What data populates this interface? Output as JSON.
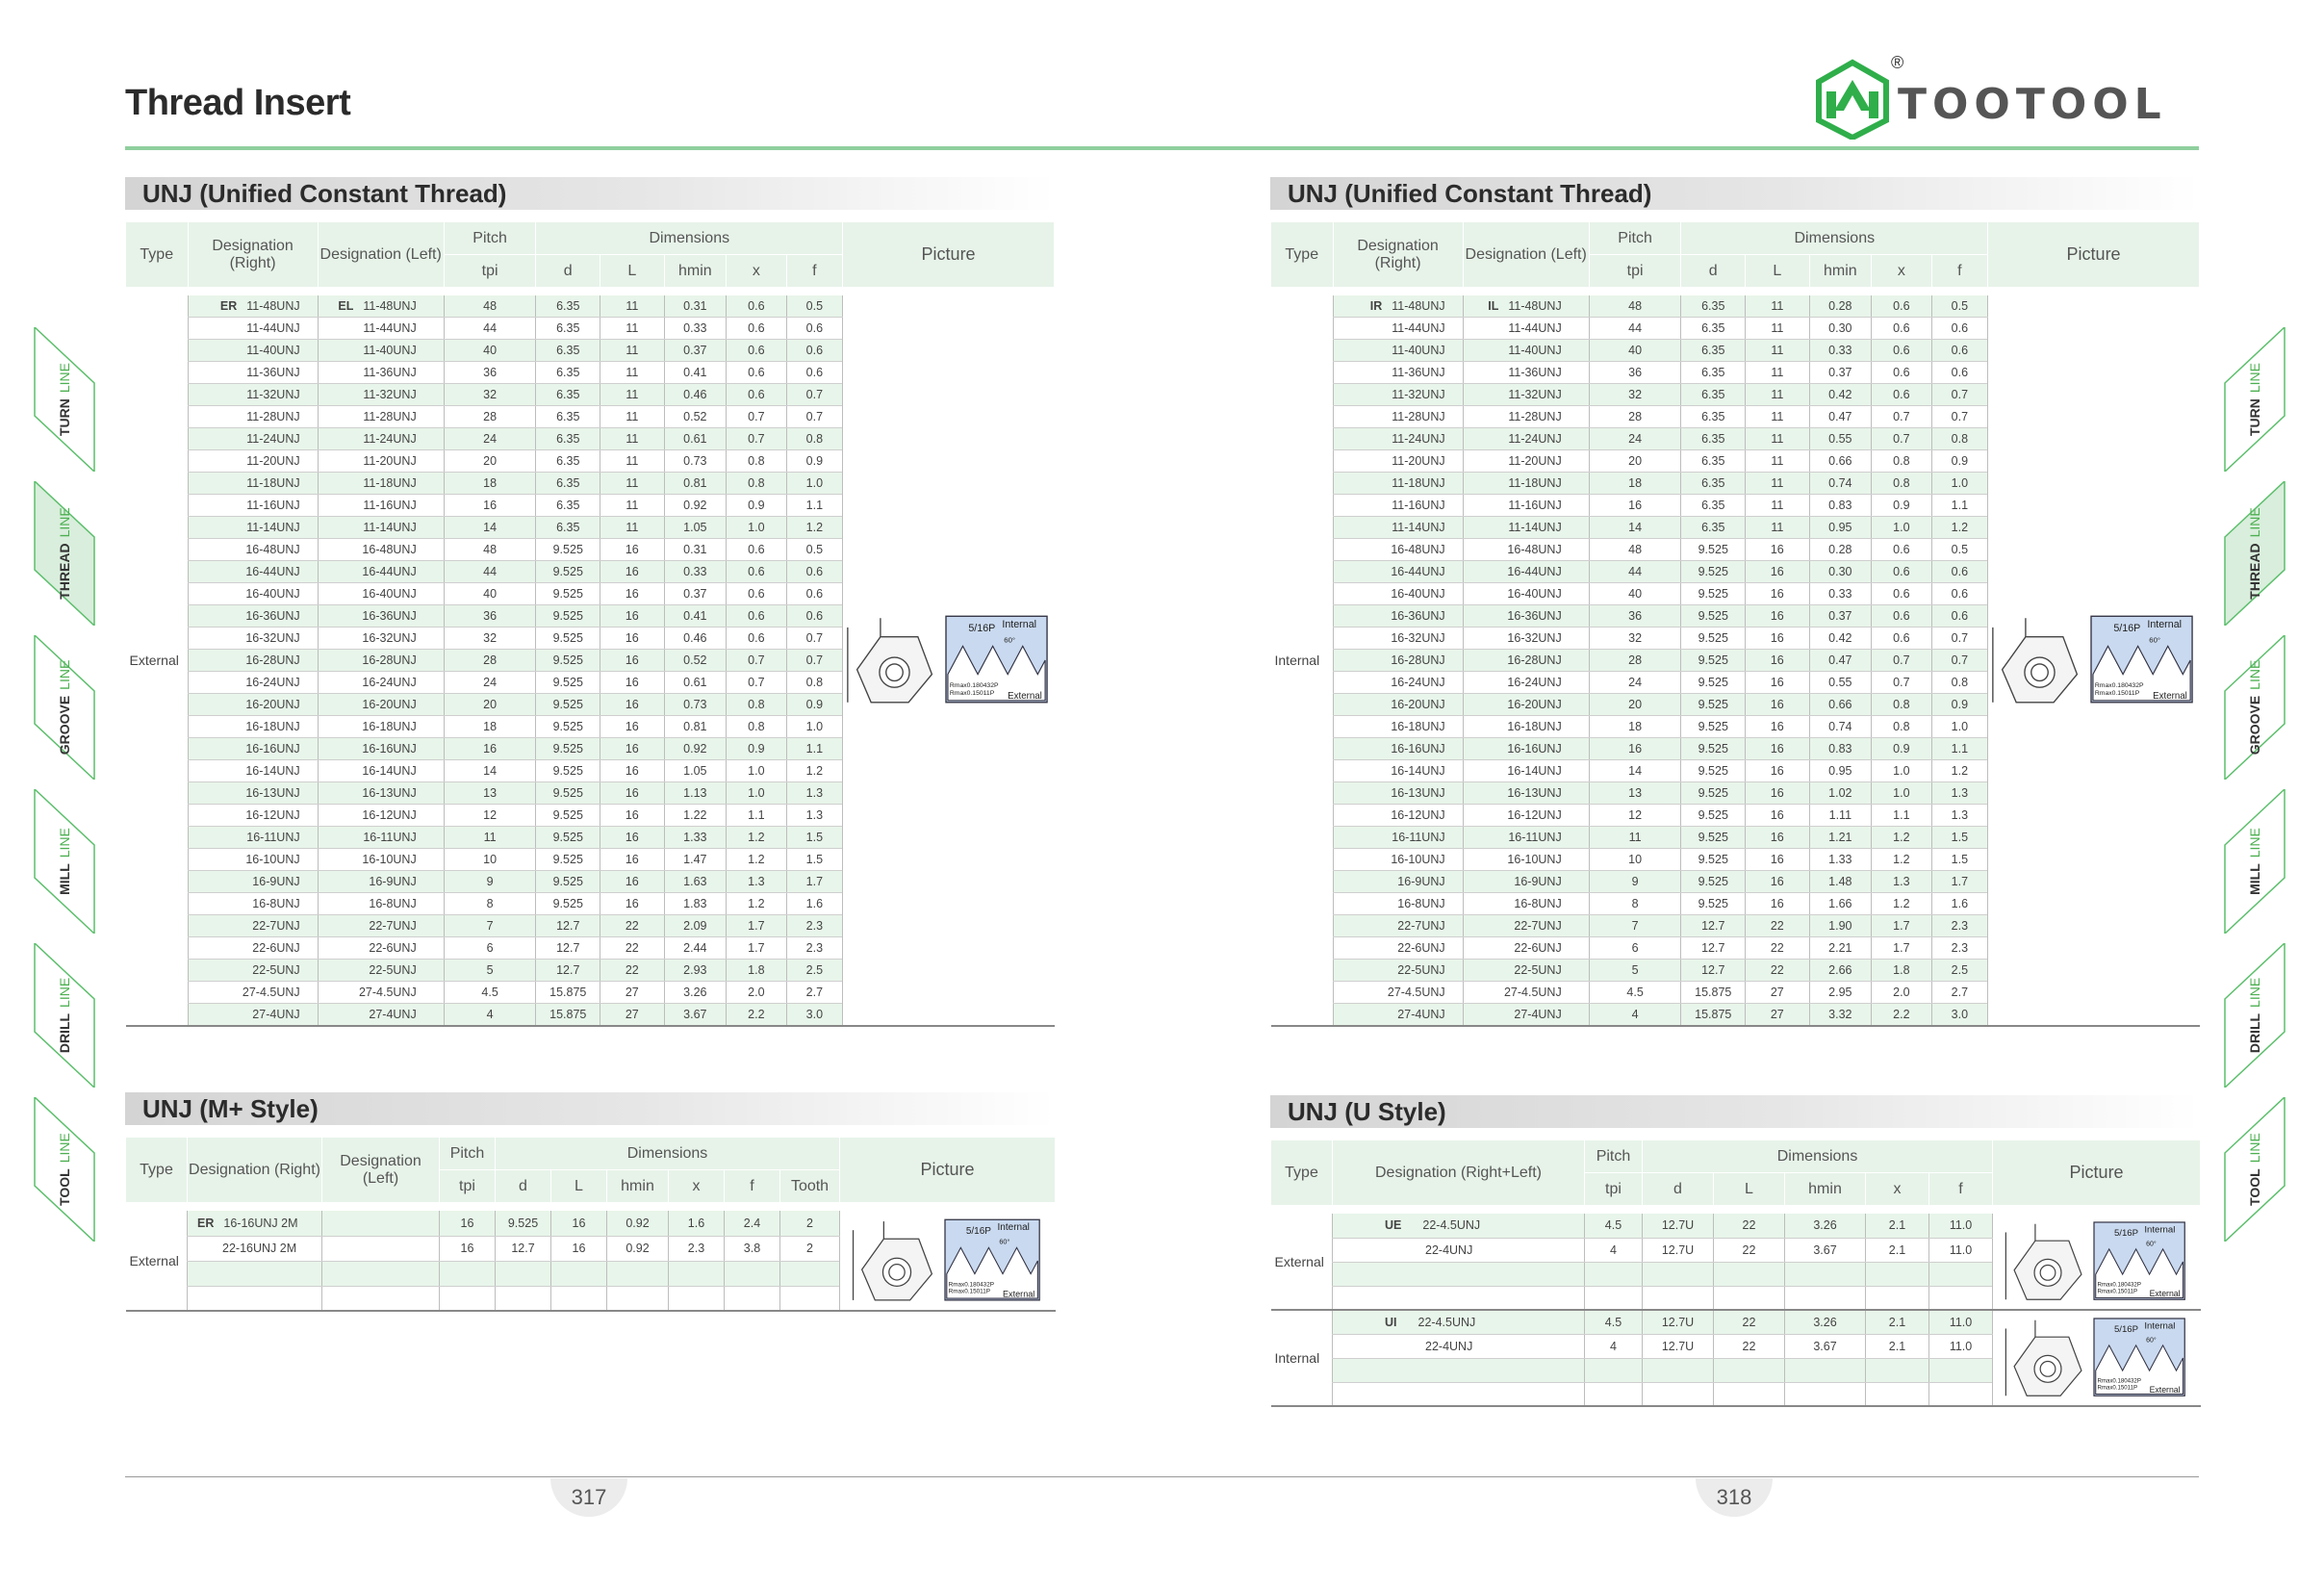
{
  "page_title": "Thread Insert",
  "logo": {
    "text": "TOOTOOL",
    "reg": "®",
    "color": "#2fae4a"
  },
  "side_tabs": [
    {
      "main": "TURN",
      "sub": "LINE"
    },
    {
      "main": "THREAD",
      "sub": "LINE"
    },
    {
      "main": "GROOVE",
      "sub": "LINE"
    },
    {
      "main": "MILL",
      "sub": "LINE"
    },
    {
      "main": "DRILL",
      "sub": "LINE"
    },
    {
      "main": "TOOL",
      "sub": "LINE"
    }
  ],
  "headers": {
    "type": "Type",
    "des_right": "Designation (Right)",
    "des_left": "Designation (Left)",
    "des_rl": "Designation (Right+Left)",
    "pitch": "Pitch",
    "tpi": "tpi",
    "dimensions": "Dimensions",
    "d": "d",
    "L": "L",
    "hmin": "hmin",
    "x": "x",
    "f": "f",
    "tooth": "Tooth",
    "picture": "Picture"
  },
  "pic_labels": {
    "pitch": "5/16P",
    "internal": "Internal",
    "external": "External",
    "angle": "60°",
    "r1": "Rmax0.180432P",
    "r2": "Rmax0.15011P"
  },
  "left_unj": {
    "title": "UNJ (Unified Constant Thread)",
    "type": "External",
    "tag_r": "ER",
    "tag_l": "EL",
    "rows": [
      [
        "11-48UNJ",
        "11-48UNJ",
        "48",
        "6.35",
        "11",
        "0.31",
        "0.6",
        "0.5"
      ],
      [
        "11-44UNJ",
        "11-44UNJ",
        "44",
        "6.35",
        "11",
        "0.33",
        "0.6",
        "0.6"
      ],
      [
        "11-40UNJ",
        "11-40UNJ",
        "40",
        "6.35",
        "11",
        "0.37",
        "0.6",
        "0.6"
      ],
      [
        "11-36UNJ",
        "11-36UNJ",
        "36",
        "6.35",
        "11",
        "0.41",
        "0.6",
        "0.6"
      ],
      [
        "11-32UNJ",
        "11-32UNJ",
        "32",
        "6.35",
        "11",
        "0.46",
        "0.6",
        "0.7"
      ],
      [
        "11-28UNJ",
        "11-28UNJ",
        "28",
        "6.35",
        "11",
        "0.52",
        "0.7",
        "0.7"
      ],
      [
        "11-24UNJ",
        "11-24UNJ",
        "24",
        "6.35",
        "11",
        "0.61",
        "0.7",
        "0.8"
      ],
      [
        "11-20UNJ",
        "11-20UNJ",
        "20",
        "6.35",
        "11",
        "0.73",
        "0.8",
        "0.9"
      ],
      [
        "11-18UNJ",
        "11-18UNJ",
        "18",
        "6.35",
        "11",
        "0.81",
        "0.8",
        "1.0"
      ],
      [
        "11-16UNJ",
        "11-16UNJ",
        "16",
        "6.35",
        "11",
        "0.92",
        "0.9",
        "1.1"
      ],
      [
        "11-14UNJ",
        "11-14UNJ",
        "14",
        "6.35",
        "11",
        "1.05",
        "1.0",
        "1.2"
      ],
      [
        "16-48UNJ",
        "16-48UNJ",
        "48",
        "9.525",
        "16",
        "0.31",
        "0.6",
        "0.5"
      ],
      [
        "16-44UNJ",
        "16-44UNJ",
        "44",
        "9.525",
        "16",
        "0.33",
        "0.6",
        "0.6"
      ],
      [
        "16-40UNJ",
        "16-40UNJ",
        "40",
        "9.525",
        "16",
        "0.37",
        "0.6",
        "0.6"
      ],
      [
        "16-36UNJ",
        "16-36UNJ",
        "36",
        "9.525",
        "16",
        "0.41",
        "0.6",
        "0.6"
      ],
      [
        "16-32UNJ",
        "16-32UNJ",
        "32",
        "9.525",
        "16",
        "0.46",
        "0.6",
        "0.7"
      ],
      [
        "16-28UNJ",
        "16-28UNJ",
        "28",
        "9.525",
        "16",
        "0.52",
        "0.7",
        "0.7"
      ],
      [
        "16-24UNJ",
        "16-24UNJ",
        "24",
        "9.525",
        "16",
        "0.61",
        "0.7",
        "0.8"
      ],
      [
        "16-20UNJ",
        "16-20UNJ",
        "20",
        "9.525",
        "16",
        "0.73",
        "0.8",
        "0.9"
      ],
      [
        "16-18UNJ",
        "16-18UNJ",
        "18",
        "9.525",
        "16",
        "0.81",
        "0.8",
        "1.0"
      ],
      [
        "16-16UNJ",
        "16-16UNJ",
        "16",
        "9.525",
        "16",
        "0.92",
        "0.9",
        "1.1"
      ],
      [
        "16-14UNJ",
        "16-14UNJ",
        "14",
        "9.525",
        "16",
        "1.05",
        "1.0",
        "1.2"
      ],
      [
        "16-13UNJ",
        "16-13UNJ",
        "13",
        "9.525",
        "16",
        "1.13",
        "1.0",
        "1.3"
      ],
      [
        "16-12UNJ",
        "16-12UNJ",
        "12",
        "9.525",
        "16",
        "1.22",
        "1.1",
        "1.3"
      ],
      [
        "16-11UNJ",
        "16-11UNJ",
        "11",
        "9.525",
        "16",
        "1.33",
        "1.2",
        "1.5"
      ],
      [
        "16-10UNJ",
        "16-10UNJ",
        "10",
        "9.525",
        "16",
        "1.47",
        "1.2",
        "1.5"
      ],
      [
        "16-9UNJ",
        "16-9UNJ",
        "9",
        "9.525",
        "16",
        "1.63",
        "1.3",
        "1.7"
      ],
      [
        "16-8UNJ",
        "16-8UNJ",
        "8",
        "9.525",
        "16",
        "1.83",
        "1.2",
        "1.6"
      ],
      [
        "22-7UNJ",
        "22-7UNJ",
        "7",
        "12.7",
        "22",
        "2.09",
        "1.7",
        "2.3"
      ],
      [
        "22-6UNJ",
        "22-6UNJ",
        "6",
        "12.7",
        "22",
        "2.44",
        "1.7",
        "2.3"
      ],
      [
        "22-5UNJ",
        "22-5UNJ",
        "5",
        "12.7",
        "22",
        "2.93",
        "1.8",
        "2.5"
      ],
      [
        "27-4.5UNJ",
        "27-4.5UNJ",
        "4.5",
        "15.875",
        "27",
        "3.26",
        "2.0",
        "2.7"
      ],
      [
        "27-4UNJ",
        "27-4UNJ",
        "4",
        "15.875",
        "27",
        "3.67",
        "2.2",
        "3.0"
      ]
    ]
  },
  "right_unj": {
    "title": "UNJ (Unified Constant Thread)",
    "type": "Internal",
    "tag_r": "IR",
    "tag_l": "IL",
    "rows": [
      [
        "11-48UNJ",
        "11-48UNJ",
        "48",
        "6.35",
        "11",
        "0.28",
        "0.6",
        "0.5"
      ],
      [
        "11-44UNJ",
        "11-44UNJ",
        "44",
        "6.35",
        "11",
        "0.30",
        "0.6",
        "0.6"
      ],
      [
        "11-40UNJ",
        "11-40UNJ",
        "40",
        "6.35",
        "11",
        "0.33",
        "0.6",
        "0.6"
      ],
      [
        "11-36UNJ",
        "11-36UNJ",
        "36",
        "6.35",
        "11",
        "0.37",
        "0.6",
        "0.6"
      ],
      [
        "11-32UNJ",
        "11-32UNJ",
        "32",
        "6.35",
        "11",
        "0.42",
        "0.6",
        "0.7"
      ],
      [
        "11-28UNJ",
        "11-28UNJ",
        "28",
        "6.35",
        "11",
        "0.47",
        "0.7",
        "0.7"
      ],
      [
        "11-24UNJ",
        "11-24UNJ",
        "24",
        "6.35",
        "11",
        "0.55",
        "0.7",
        "0.8"
      ],
      [
        "11-20UNJ",
        "11-20UNJ",
        "20",
        "6.35",
        "11",
        "0.66",
        "0.8",
        "0.9"
      ],
      [
        "11-18UNJ",
        "11-18UNJ",
        "18",
        "6.35",
        "11",
        "0.74",
        "0.8",
        "1.0"
      ],
      [
        "11-16UNJ",
        "11-16UNJ",
        "16",
        "6.35",
        "11",
        "0.83",
        "0.9",
        "1.1"
      ],
      [
        "11-14UNJ",
        "11-14UNJ",
        "14",
        "6.35",
        "11",
        "0.95",
        "1.0",
        "1.2"
      ],
      [
        "16-48UNJ",
        "16-48UNJ",
        "48",
        "9.525",
        "16",
        "0.28",
        "0.6",
        "0.5"
      ],
      [
        "16-44UNJ",
        "16-44UNJ",
        "44",
        "9.525",
        "16",
        "0.30",
        "0.6",
        "0.6"
      ],
      [
        "16-40UNJ",
        "16-40UNJ",
        "40",
        "9.525",
        "16",
        "0.33",
        "0.6",
        "0.6"
      ],
      [
        "16-36UNJ",
        "16-36UNJ",
        "36",
        "9.525",
        "16",
        "0.37",
        "0.6",
        "0.6"
      ],
      [
        "16-32UNJ",
        "16-32UNJ",
        "32",
        "9.525",
        "16",
        "0.42",
        "0.6",
        "0.7"
      ],
      [
        "16-28UNJ",
        "16-28UNJ",
        "28",
        "9.525",
        "16",
        "0.47",
        "0.7",
        "0.7"
      ],
      [
        "16-24UNJ",
        "16-24UNJ",
        "24",
        "9.525",
        "16",
        "0.55",
        "0.7",
        "0.8"
      ],
      [
        "16-20UNJ",
        "16-20UNJ",
        "20",
        "9.525",
        "16",
        "0.66",
        "0.8",
        "0.9"
      ],
      [
        "16-18UNJ",
        "16-18UNJ",
        "18",
        "9.525",
        "16",
        "0.74",
        "0.8",
        "1.0"
      ],
      [
        "16-16UNJ",
        "16-16UNJ",
        "16",
        "9.525",
        "16",
        "0.83",
        "0.9",
        "1.1"
      ],
      [
        "16-14UNJ",
        "16-14UNJ",
        "14",
        "9.525",
        "16",
        "0.95",
        "1.0",
        "1.2"
      ],
      [
        "16-13UNJ",
        "16-13UNJ",
        "13",
        "9.525",
        "16",
        "1.02",
        "1.0",
        "1.3"
      ],
      [
        "16-12UNJ",
        "16-12UNJ",
        "12",
        "9.525",
        "16",
        "1.11",
        "1.1",
        "1.3"
      ],
      [
        "16-11UNJ",
        "16-11UNJ",
        "11",
        "9.525",
        "16",
        "1.21",
        "1.2",
        "1.5"
      ],
      [
        "16-10UNJ",
        "16-10UNJ",
        "10",
        "9.525",
        "16",
        "1.33",
        "1.2",
        "1.5"
      ],
      [
        "16-9UNJ",
        "16-9UNJ",
        "9",
        "9.525",
        "16",
        "1.48",
        "1.3",
        "1.7"
      ],
      [
        "16-8UNJ",
        "16-8UNJ",
        "8",
        "9.525",
        "16",
        "1.66",
        "1.2",
        "1.6"
      ],
      [
        "22-7UNJ",
        "22-7UNJ",
        "7",
        "12.7",
        "22",
        "1.90",
        "1.7",
        "2.3"
      ],
      [
        "22-6UNJ",
        "22-6UNJ",
        "6",
        "12.7",
        "22",
        "2.21",
        "1.7",
        "2.3"
      ],
      [
        "22-5UNJ",
        "22-5UNJ",
        "5",
        "12.7",
        "22",
        "2.66",
        "1.8",
        "2.5"
      ],
      [
        "27-4.5UNJ",
        "27-4.5UNJ",
        "4.5",
        "15.875",
        "27",
        "2.95",
        "2.0",
        "2.7"
      ],
      [
        "27-4UNJ",
        "27-4UNJ",
        "4",
        "15.875",
        "27",
        "3.32",
        "2.2",
        "3.0"
      ]
    ]
  },
  "mplus": {
    "title": "UNJ (M+ Style)",
    "type": "External",
    "tag": "ER",
    "rows": [
      [
        "16-16UNJ 2M",
        "",
        "16",
        "9.525",
        "16",
        "0.92",
        "1.6",
        "2.4",
        "2"
      ],
      [
        "22-16UNJ 2M",
        "",
        "16",
        "12.7",
        "16",
        "0.92",
        "2.3",
        "3.8",
        "2"
      ],
      [
        "",
        "",
        "",
        "",
        "",
        "",
        "",
        "",
        ""
      ],
      [
        "",
        "",
        "",
        "",
        "",
        "",
        "",
        "",
        ""
      ]
    ]
  },
  "ustyle": {
    "title": "UNJ (U Style)",
    "external": {
      "type": "External",
      "tag": "UE",
      "rows": [
        [
          "22-4.5UNJ",
          "4.5",
          "12.7U",
          "22",
          "3.26",
          "2.1",
          "11.0"
        ],
        [
          "22-4UNJ",
          "4",
          "12.7U",
          "22",
          "3.67",
          "2.1",
          "11.0"
        ],
        [
          "",
          "",
          "",
          "",
          "",
          "",
          ""
        ],
        [
          "",
          "",
          "",
          "",
          "",
          "",
          ""
        ]
      ]
    },
    "internal": {
      "type": "Internal",
      "tag": "UI",
      "rows": [
        [
          "22-4.5UNJ",
          "4.5",
          "12.7U",
          "22",
          "3.26",
          "2.1",
          "11.0"
        ],
        [
          "22-4UNJ",
          "4",
          "12.7U",
          "22",
          "3.67",
          "2.1",
          "11.0"
        ],
        [
          "",
          "",
          "",
          "",
          "",
          "",
          ""
        ],
        [
          "",
          "",
          "",
          "",
          "",
          "",
          ""
        ]
      ]
    }
  },
  "page_numbers": {
    "left": "317",
    "right": "318"
  }
}
